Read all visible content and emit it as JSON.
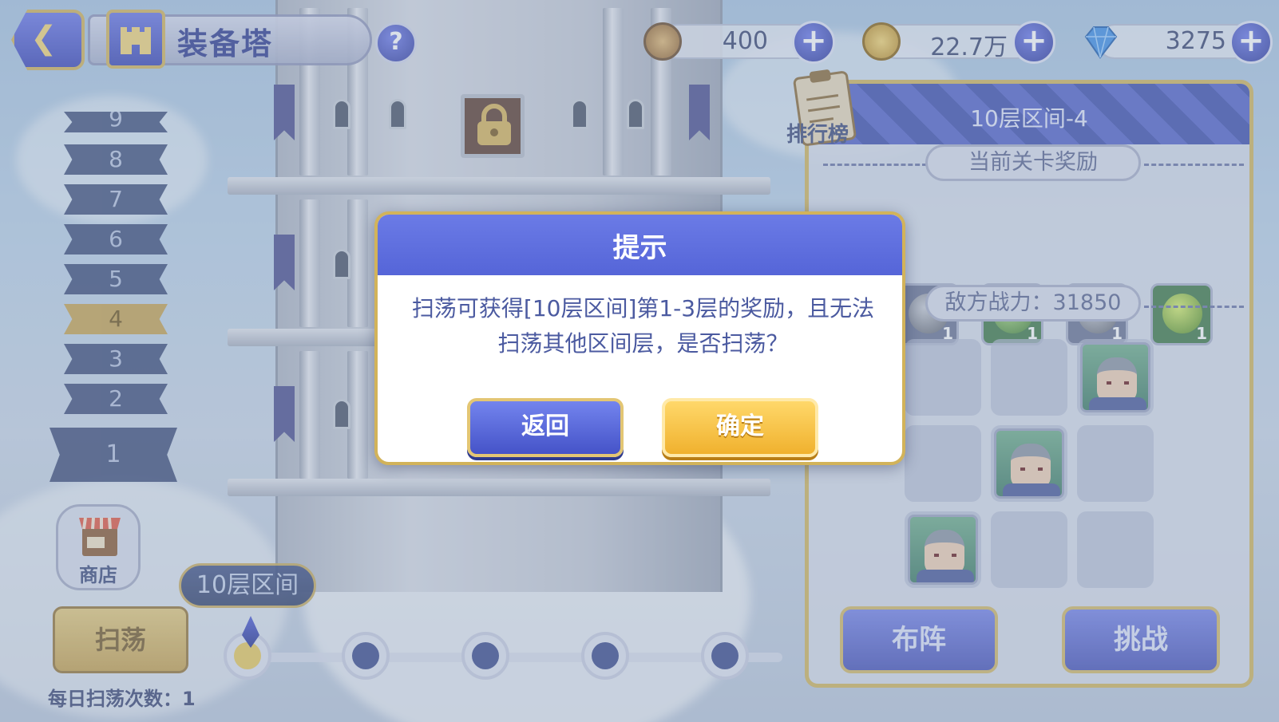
{
  "header": {
    "title": "装备塔",
    "help_icon": "?",
    "back_icon": "back-arrow-icon"
  },
  "resources": [
    {
      "icon": "stamina-coin-icon",
      "value": "400",
      "color": "#b58a4a"
    },
    {
      "icon": "gold-coin-icon",
      "value": "22.7万",
      "color": "#d9b24a"
    },
    {
      "icon": "blue-diamond-icon",
      "value": "3275",
      "color": "#3f8fe6"
    }
  ],
  "floors": [
    "9",
    "8",
    "7",
    "6",
    "5",
    "4",
    "3",
    "2",
    "1"
  ],
  "active_floor": "4",
  "shop": {
    "label": "商店"
  },
  "range_label": "10层区间",
  "sweep": {
    "label": "扫荡",
    "count_text": "每日扫荡次数：1"
  },
  "panel": {
    "ranking_label": "排行榜",
    "title": "10层区间-4",
    "reward_header": "当前关卡奖励",
    "rewards": [
      {
        "icon": "purple-item-icon",
        "qty": ""
      },
      {
        "icon": "gray-helmet-icon",
        "qty": "1"
      },
      {
        "icon": "green-helmet-icon",
        "qty": "1"
      },
      {
        "icon": "gray-crown-icon",
        "qty": "1"
      },
      {
        "icon": "green-crown-icon",
        "qty": "1"
      }
    ],
    "enemy_power": "敌方战力：31850",
    "formation_button": "布阵",
    "challenge_button": "挑战"
  },
  "dialog": {
    "title": "提示",
    "message_line1": "扫荡可获得[10层区间]第1-3层的奖励，且无法",
    "message_line2": "扫荡其他区间层，是否扫荡？",
    "cancel_label": "返回",
    "confirm_label": "确定"
  }
}
